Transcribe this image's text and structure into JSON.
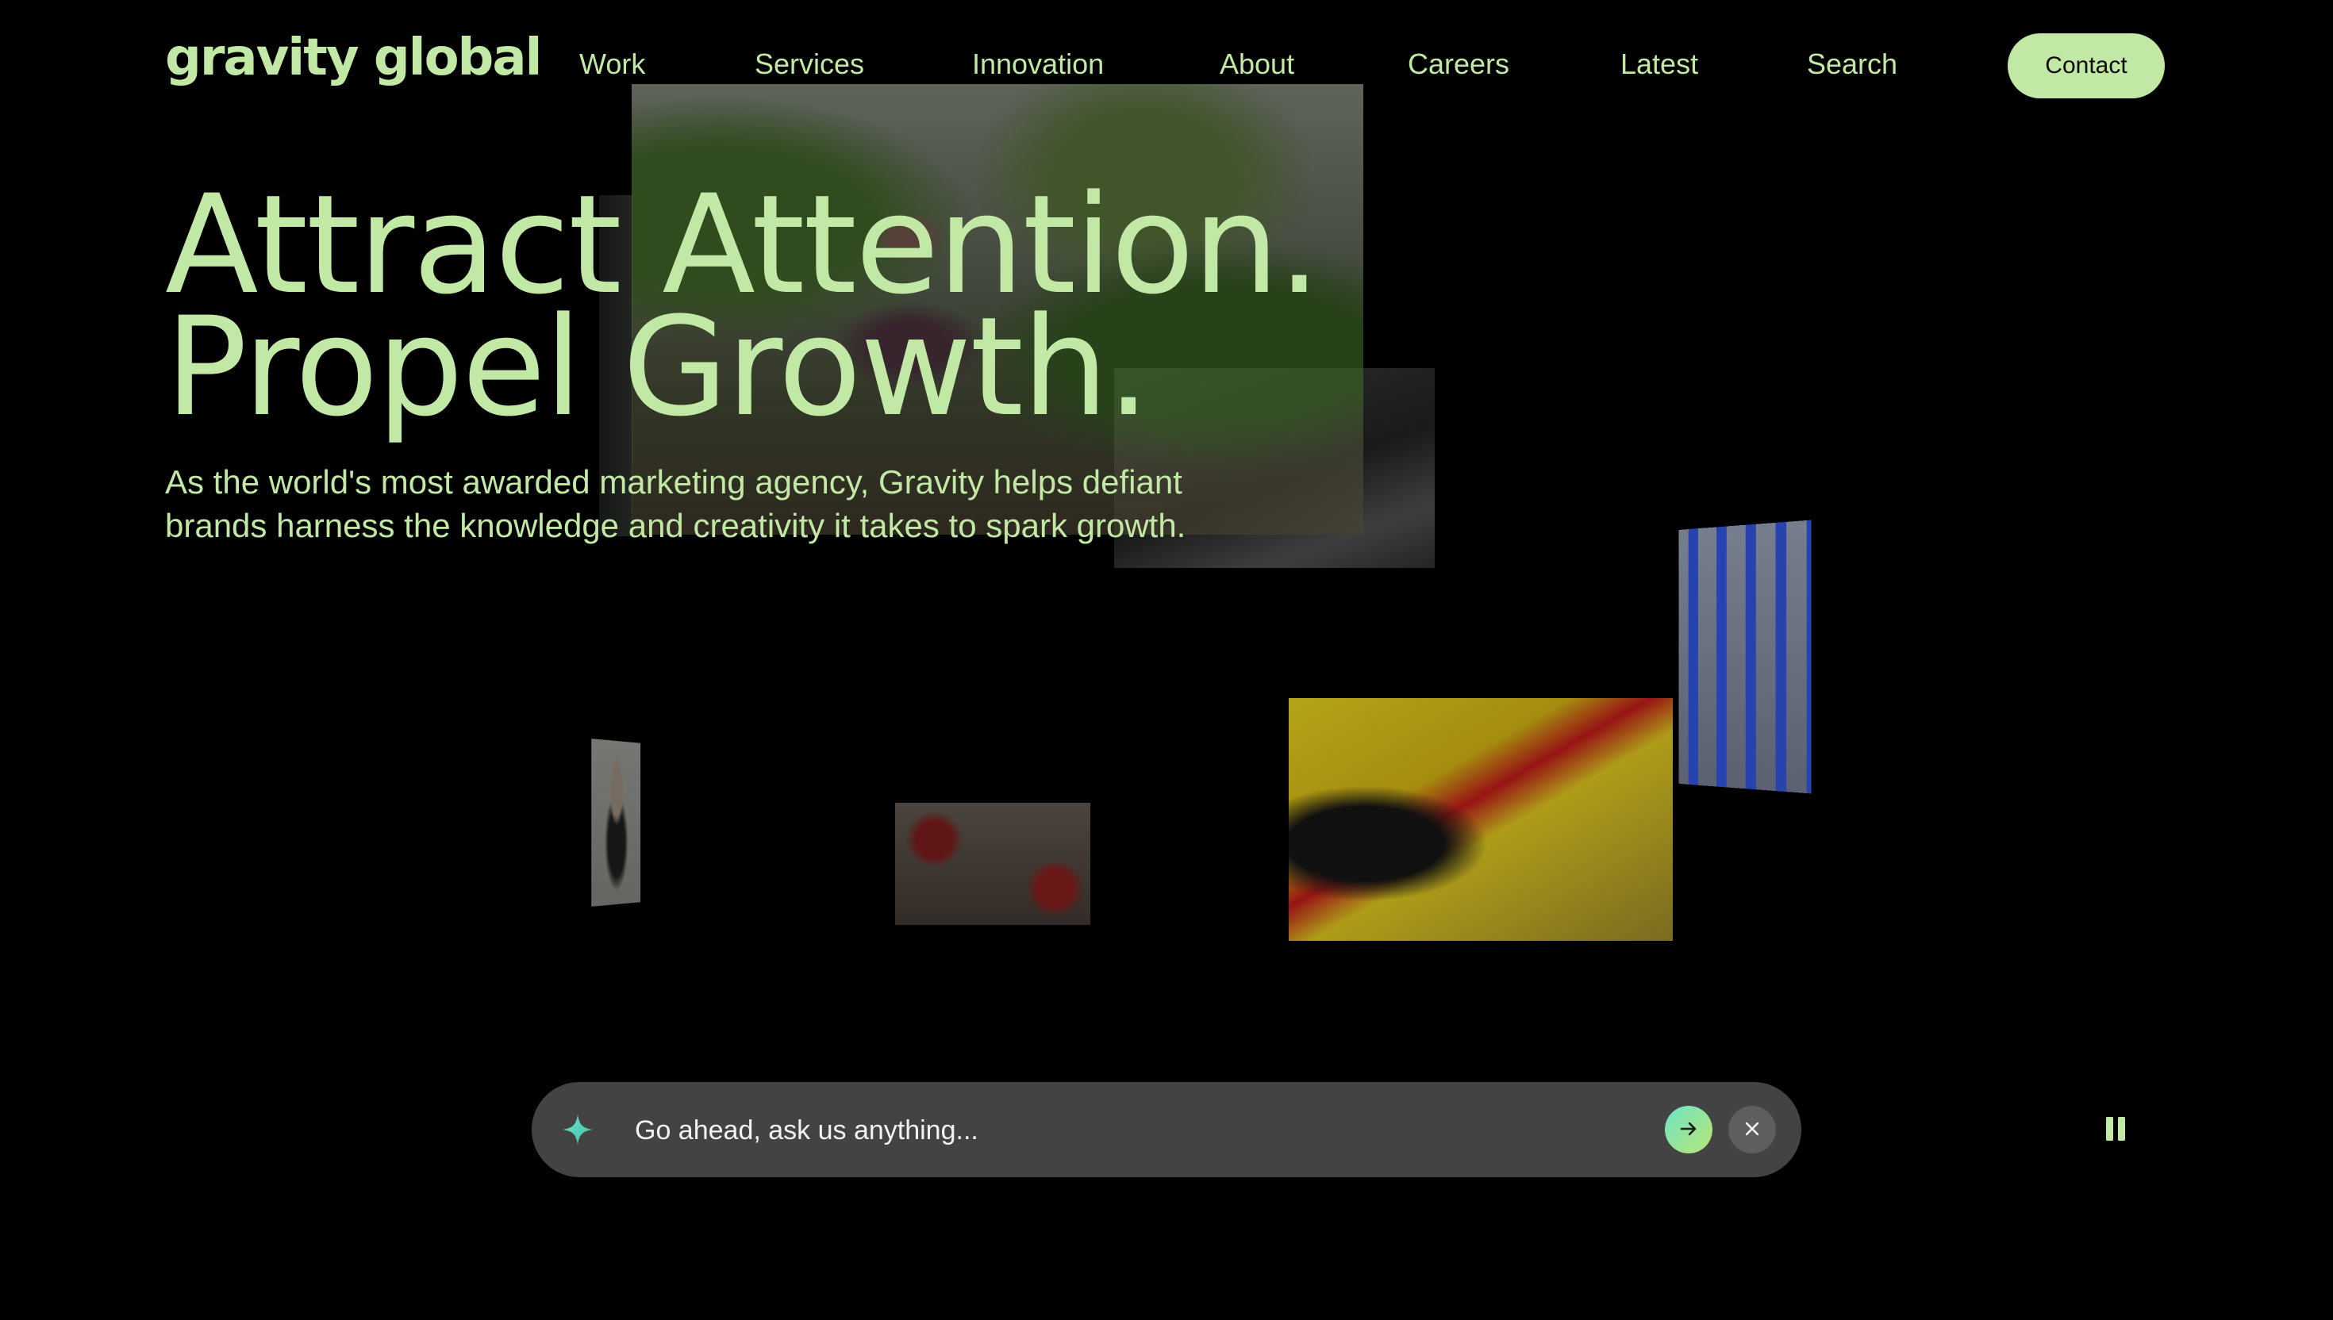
{
  "header": {
    "logo": "gravity global",
    "nav": [
      "Work",
      "Services",
      "Innovation",
      "About",
      "Careers",
      "Latest",
      "Search"
    ],
    "contact_label": "Contact"
  },
  "hero": {
    "title_line1": "Attract Attention.",
    "title_line2": "Propel Growth.",
    "subtitle_line1": "As the world's most awarded marketing agency, Gravity helps defiant",
    "subtitle_line2": "brands harness the knowledge and creativity it takes to spark growth."
  },
  "ask": {
    "placeholder": "Go ahead, ask us anything...",
    "icons": {
      "sparkle": "sparkle-icon",
      "submit": "arrow-right-icon",
      "close": "close-icon",
      "pause": "pause-icon"
    }
  },
  "colors": {
    "background": "#000000",
    "accent": "#c2e8a6",
    "ask_bar": "#434343",
    "submit_gradient_start": "#6fe3c4",
    "submit_gradient_end": "#b8e676"
  }
}
